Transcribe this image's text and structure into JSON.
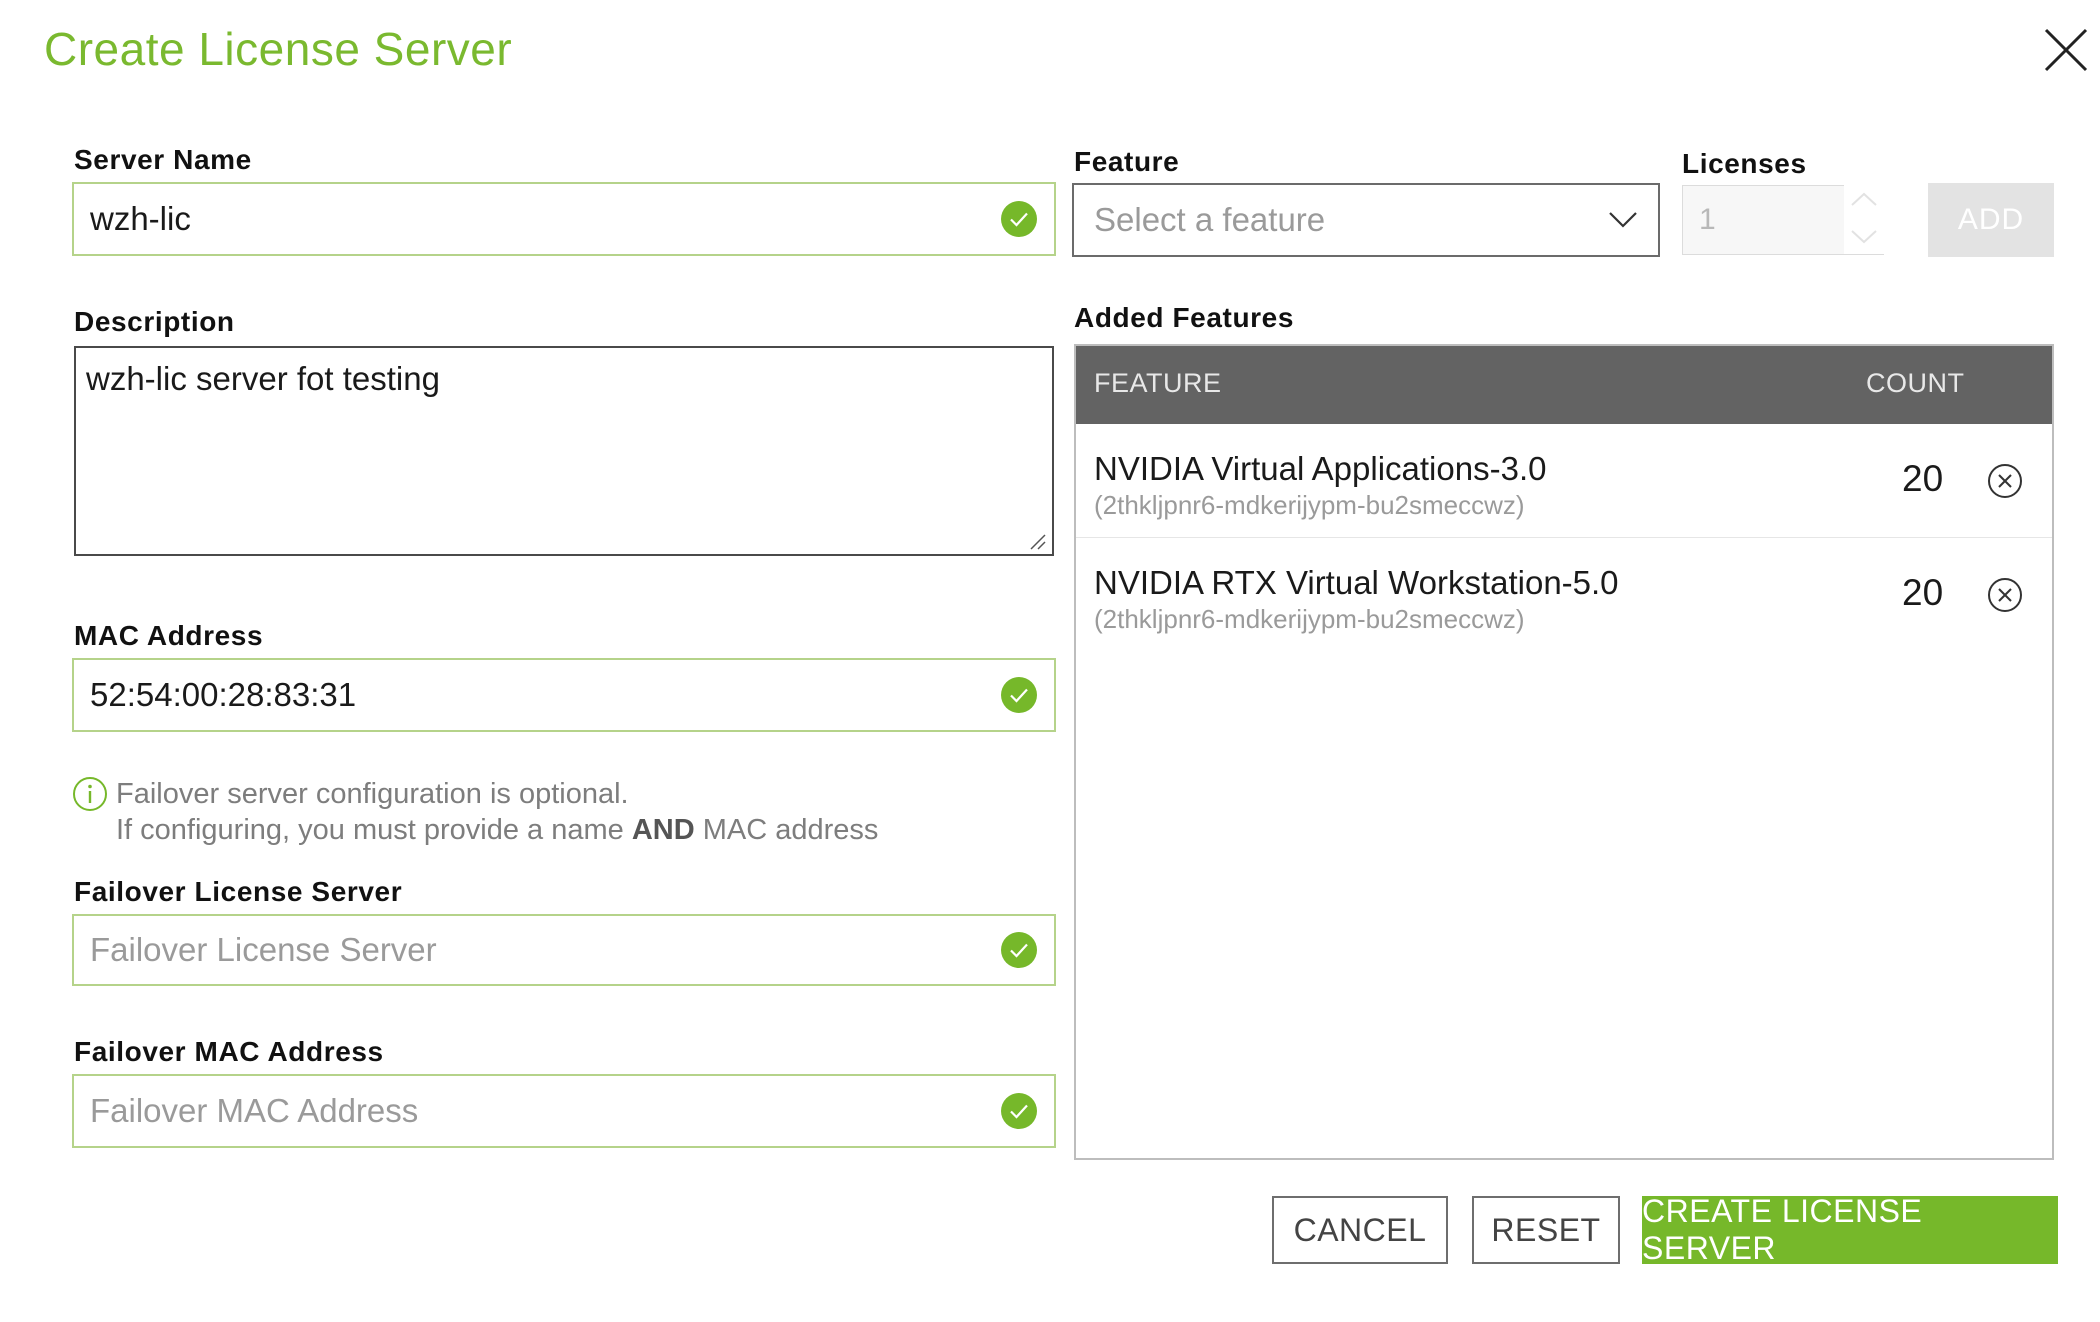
{
  "dialog": {
    "title": "Create License Server"
  },
  "colors": {
    "accent": "#76b82a",
    "table_header": "#636363"
  },
  "form": {
    "server_name": {
      "label": "Server Name",
      "value": "wzh-lic",
      "status_icon": "check-circle-icon"
    },
    "description": {
      "label": "Description",
      "value": "wzh-lic server fot testing"
    },
    "mac_address": {
      "label": "MAC Address",
      "value": "52:54:00:28:83:31",
      "status_icon": "check-circle-icon"
    },
    "failover_note": {
      "line1": "Failover server configuration is optional.",
      "line2_pre": "If configuring, you must provide a name ",
      "line2_bold": "AND",
      "line2_post": " MAC address"
    },
    "failover_server": {
      "label": "Failover License Server",
      "placeholder": "Failover License Server",
      "status_icon": "check-circle-icon"
    },
    "failover_mac": {
      "label": "Failover MAC Address",
      "placeholder": "Failover MAC Address",
      "status_icon": "check-circle-icon"
    }
  },
  "feature_picker": {
    "label": "Feature",
    "placeholder": "Select a feature",
    "licenses_label": "Licenses",
    "licenses_value": "1",
    "add_label": "ADD"
  },
  "added_features": {
    "label": "Added Features",
    "columns": {
      "feature": "FEATURE",
      "count": "COUNT"
    },
    "rows": [
      {
        "name": "NVIDIA Virtual Applications-3.0",
        "id": "(2thkljpnr6-mdkerijypm-bu2smeccwz)",
        "count": "20"
      },
      {
        "name": "NVIDIA RTX Virtual Workstation-5.0",
        "id": "(2thkljpnr6-mdkerijypm-bu2smeccwz)",
        "count": "20"
      }
    ]
  },
  "actions": {
    "cancel": "CANCEL",
    "reset": "RESET",
    "create": "CREATE LICENSE SERVER"
  }
}
